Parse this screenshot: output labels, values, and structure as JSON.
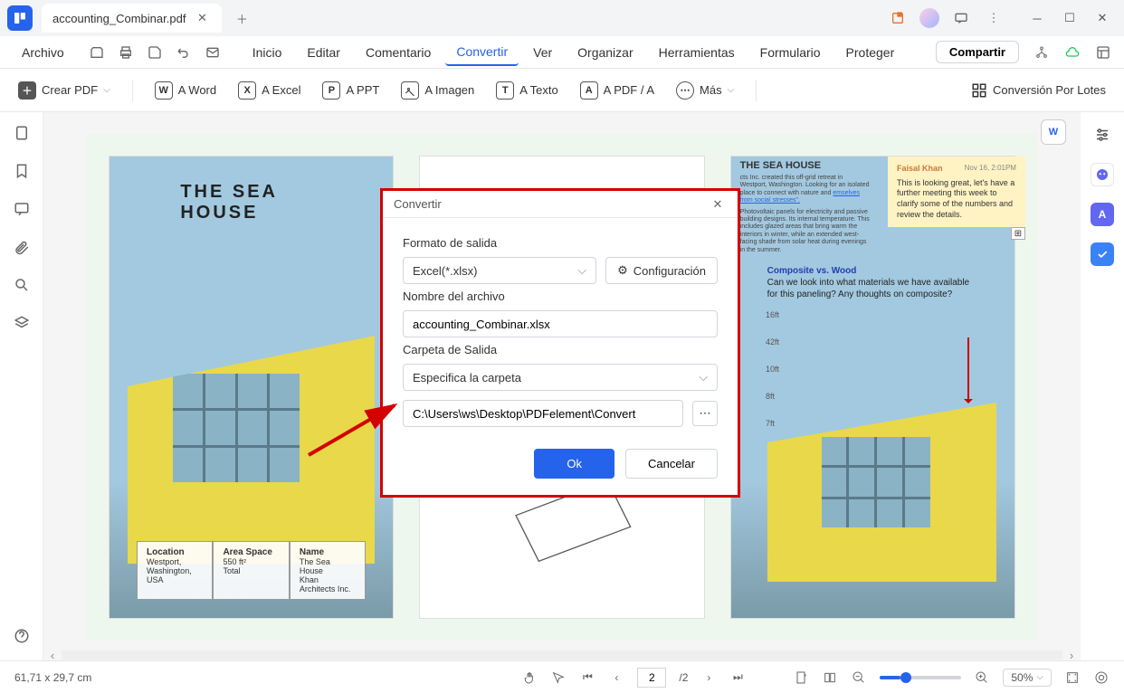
{
  "tab": {
    "title": "accounting_Combinar.pdf"
  },
  "menu": {
    "file": "Archivo",
    "items": [
      "Inicio",
      "Editar",
      "Comentario",
      "Convertir",
      "Ver",
      "Organizar",
      "Herramientas",
      "Formulario",
      "Proteger"
    ],
    "active_index": 3,
    "share": "Compartir"
  },
  "toolbar": {
    "create": "Crear PDF",
    "word": "A Word",
    "excel": "A Excel",
    "ppt": "A PPT",
    "image": "A Imagen",
    "text": "A Texto",
    "pdfa": "A PDF / A",
    "more": "Más",
    "batch": "Conversión Por Lotes"
  },
  "dialog": {
    "title": "Convertir",
    "format_label": "Formato de salida",
    "format_value": "Excel(*.xlsx)",
    "config": "Configuración",
    "name_label": "Nombre del archivo",
    "name_value": "accounting_Combinar.xlsx",
    "folder_label": "Carpeta de Salida",
    "folder_value": "Especifica la carpeta",
    "path_value": "C:\\Users\\ws\\Desktop\\PDFelement\\Convert",
    "ok": "Ok",
    "cancel": "Cancelar"
  },
  "doc": {
    "card1_title": "THE SEA HOUSE",
    "info": {
      "location_h": "Location",
      "location_v1": "Westport,",
      "location_v2": "Washington, USA",
      "area_h": "Area Space",
      "area_v1": "550 ft²",
      "area_v2": "Total",
      "name_h": "Name",
      "name_v1": "The Sea House",
      "name_v2": "Khan Architects Inc."
    },
    "card3_title": "THE SEA HOUSE",
    "card3_body": "cts Inc. created this off-grid retreat in Westport, Washington. Looking for an isolated place to connect with nature and",
    "card3_link": "emselves from social stresses\".",
    "card3_p2": "Photovoltaic panels for electricity and passive building designs. Its internal temperature. This includes glazed areas that bring warm the interiors in winter, while an extended west-facing shade from solar heat during evenings in the summer.",
    "comment": {
      "author": "Faisal Khan",
      "date": "Nov 16, 2:01PM",
      "text": "This is looking great, let's have a further meeting this week to clarify some of the numbers and review the details."
    },
    "annot_title": "Composite vs. Wood",
    "annot_body": "Can we look into what materials we have available for this paneling? Any thoughts on composite?",
    "dims": [
      "16ft",
      "42ft",
      "10ft",
      "8ft",
      "7ft"
    ]
  },
  "status": {
    "dims": "61,71 x 29,7 cm",
    "page_current": "2",
    "page_total": "/2",
    "zoom": "50%"
  }
}
